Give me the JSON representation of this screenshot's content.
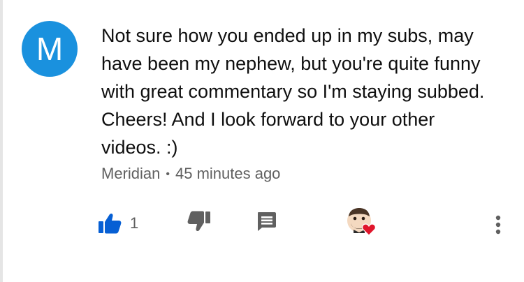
{
  "comment": {
    "avatar_letter": "M",
    "text_lines": [
      "Not sure how you ended up in my subs, may",
      "have been my nephew, but you're quite funny",
      "with great commentary so I'm staying subbed.",
      "Cheers! And I look forward to your other",
      "videos. :)"
    ],
    "author": "Meridian",
    "separator": "•",
    "timestamp": "45 minutes ago"
  },
  "actions": {
    "like_count": "1",
    "like_icon": "thumbs-up-icon",
    "dislike_icon": "thumbs-down-icon",
    "reply_icon": "comment-icon",
    "more_icon": "more-vertical-icon"
  },
  "colors": {
    "avatar_bg": "#1a91de",
    "like_active": "#065fd4",
    "icon_gray": "#606060",
    "heart_red": "#e0152b"
  }
}
